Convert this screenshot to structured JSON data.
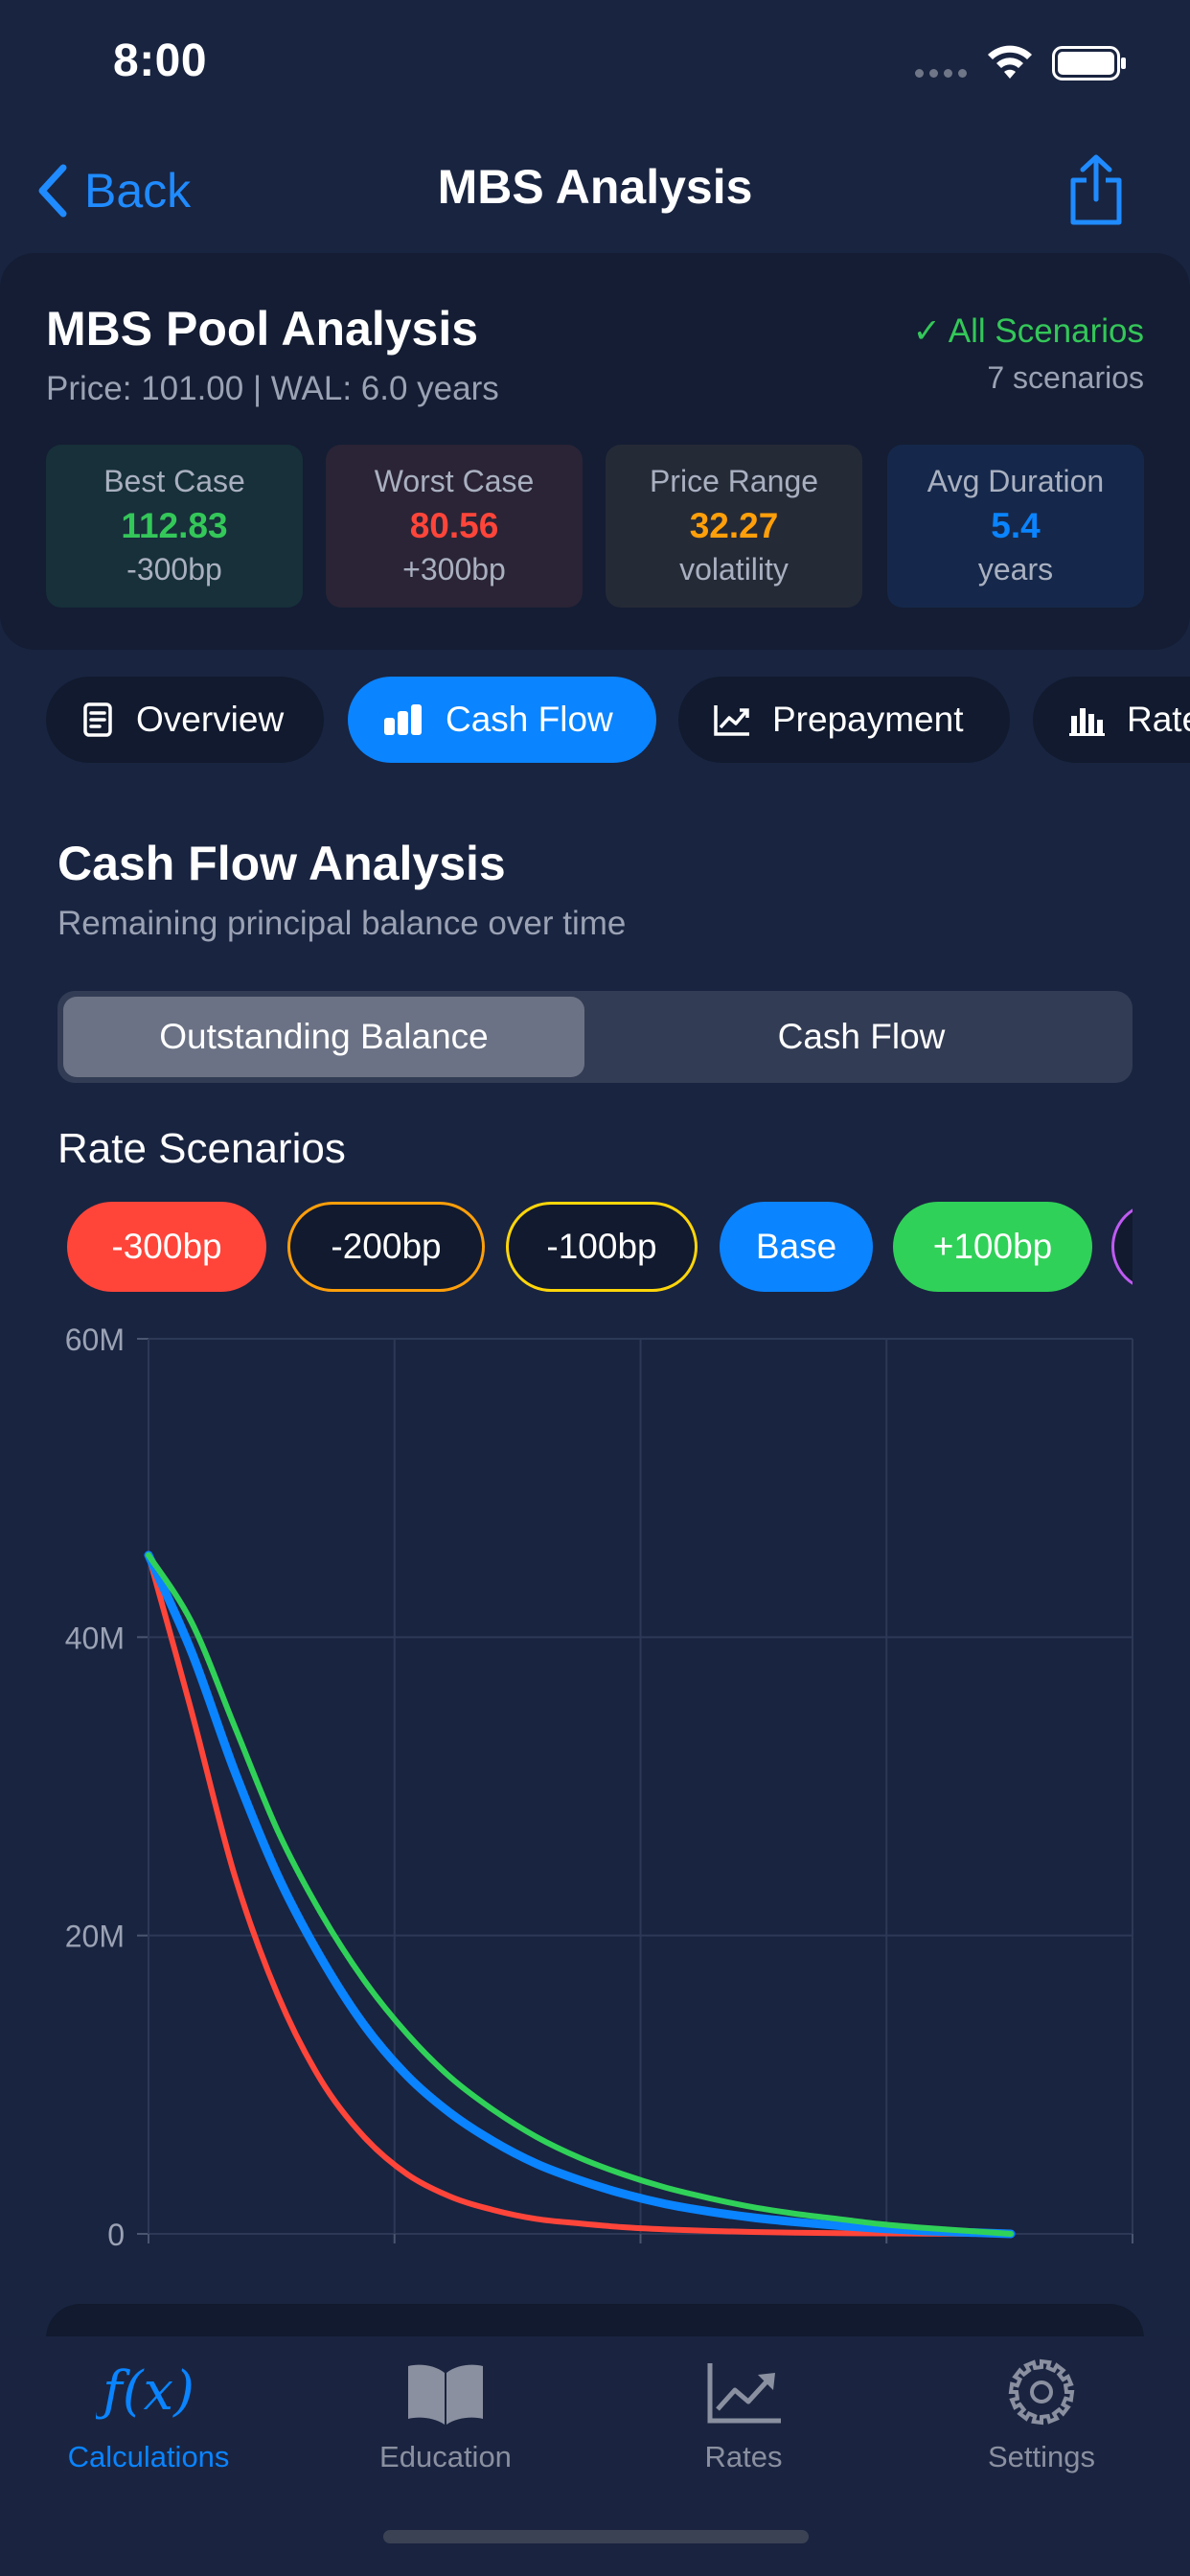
{
  "status_bar": {
    "time": "8:00"
  },
  "nav": {
    "back_label": "Back",
    "title": "MBS Analysis"
  },
  "summary": {
    "title": "MBS Pool Analysis",
    "subtitle": "Price: 101.00 | WAL: 6.0 years",
    "status": "✓ All Scenarios",
    "count": "7 scenarios",
    "metrics": [
      {
        "label": "Best Case",
        "value": "112.83",
        "note": "-300bp",
        "color": "#34c759",
        "bg": "#17303a"
      },
      {
        "label": "Worst Case",
        "value": "80.56",
        "note": "+300bp",
        "color": "#ff453a",
        "bg": "#2a2436"
      },
      {
        "label": "Price Range",
        "value": "32.27",
        "note": "volatility",
        "color": "#ff9f0a",
        "bg": "#252a37"
      },
      {
        "label": "Avg Duration",
        "value": "5.4",
        "note": "years",
        "color": "#0a84ff",
        "bg": "#15284b"
      }
    ]
  },
  "tabs": [
    {
      "label": "Overview",
      "icon": "document-icon"
    },
    {
      "label": "Cash Flow",
      "icon": "bar-chart-icon"
    },
    {
      "label": "Prepayment",
      "icon": "trend-chart-icon"
    },
    {
      "label": "Rate",
      "icon": "bars-icon"
    }
  ],
  "active_tab": "Cash Flow",
  "section": {
    "title": "Cash Flow Analysis",
    "subtitle": "Remaining principal balance over time"
  },
  "segmented": {
    "options": [
      "Outstanding Balance",
      "Cash Flow"
    ],
    "selected": "Outstanding Balance"
  },
  "rate_scenarios": {
    "title": "Rate Scenarios",
    "chips": [
      {
        "label": "-300bp",
        "state": "selected",
        "color": "#ff453a"
      },
      {
        "label": "-200bp",
        "state": "outline",
        "color": "#ff9f0a"
      },
      {
        "label": "-100bp",
        "state": "outline",
        "color": "#ffd60a"
      },
      {
        "label": "Base",
        "state": "selected",
        "color": "#0a84ff"
      },
      {
        "label": "+100bp",
        "state": "selected",
        "color": "#30d158"
      },
      {
        "label": "",
        "state": "outline",
        "color": "#bf5af2"
      }
    ]
  },
  "chart_data": {
    "type": "line",
    "y_ticks": [
      "60M",
      "40M",
      "20M",
      "0"
    ],
    "ylim": [
      0,
      60
    ],
    "xlim": [
      0,
      10
    ],
    "grid": true,
    "x": [
      0,
      0.5,
      1,
      1.5,
      2,
      2.5,
      3,
      3.5,
      4,
      4.5,
      5,
      5.5,
      6,
      6.5,
      7,
      7.5,
      8,
      8.5,
      9,
      9.5,
      10
    ],
    "series": [
      {
        "scenario": "-300bp",
        "color": "#ff453a",
        "values": [
          45.5,
          35,
          24,
          16,
          10.3,
          6.5,
          4,
          2.5,
          1.6,
          1.0,
          0.7,
          0.45,
          0.3,
          0.2,
          0.13,
          0.08,
          0.05,
          0.03,
          0.02,
          0.01,
          0
        ]
      },
      {
        "scenario": "Base",
        "color": "#0a84ff",
        "values": [
          45.5,
          39,
          31,
          24,
          18.5,
          14,
          10.6,
          8.1,
          6.2,
          4.7,
          3.6,
          2.7,
          2.0,
          1.5,
          1.1,
          0.8,
          0.55,
          0.35,
          0.2,
          0.1,
          0
        ]
      },
      {
        "scenario": "+100bp",
        "color": "#30d158",
        "values": [
          45.5,
          41,
          34,
          27,
          21.5,
          17,
          13.4,
          10.5,
          8.3,
          6.5,
          5.1,
          4.0,
          3.1,
          2.4,
          1.8,
          1.35,
          1.0,
          0.65,
          0.4,
          0.2,
          0
        ]
      }
    ]
  },
  "tab_bar": {
    "items": [
      {
        "label": "Calculations",
        "icon": "function-icon"
      },
      {
        "label": "Education",
        "icon": "book-icon"
      },
      {
        "label": "Rates",
        "icon": "chart-up-icon"
      },
      {
        "label": "Settings",
        "icon": "gear-icon"
      }
    ],
    "active": "Calculations"
  }
}
